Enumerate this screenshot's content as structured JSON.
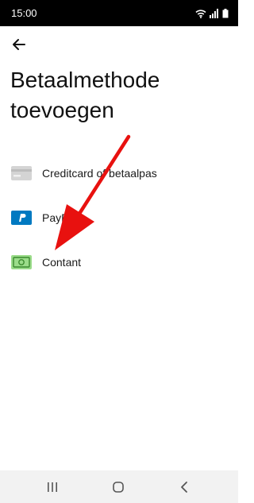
{
  "status_bar": {
    "time": "15:00",
    "icons": [
      "wifi-icon",
      "signal-icon",
      "battery-icon"
    ]
  },
  "header": {
    "back_icon": "arrow-left-icon",
    "title": "Betaalmethode toevoegen"
  },
  "payment_methods": [
    {
      "label": "Creditcard of betaalpas",
      "icon": "credit-card-icon"
    },
    {
      "label": "PayPal",
      "icon": "paypal-icon"
    },
    {
      "label": "Contant",
      "icon": "cash-icon"
    }
  ],
  "annotation": {
    "icon": "red-arrow-icon",
    "color": "#e8110f"
  },
  "nav_bar": {
    "icons": [
      "recent-apps-icon",
      "home-icon",
      "back-icon"
    ]
  },
  "colors": {
    "status_bar": "#000000",
    "nav_bar": "#f2f2f2",
    "paypal": "#0079c1",
    "cash": "#3b8a2e"
  }
}
